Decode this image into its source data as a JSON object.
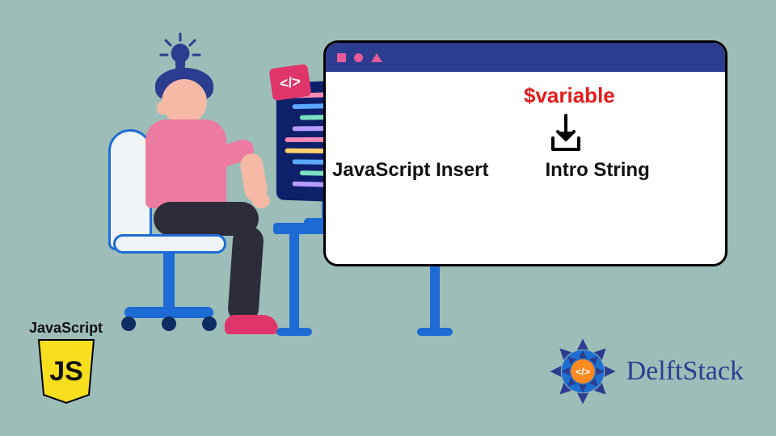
{
  "browser": {
    "variable": "$variable",
    "insert_left": "JavaScript Insert",
    "insert_right": "Intro String"
  },
  "code_badge": "</>",
  "js_logo": {
    "label": "JavaScript",
    "shield_text": "JS"
  },
  "delftstack": {
    "name": "DelftStack",
    "badge": "</>"
  },
  "colors": {
    "bg": "#9dbdb8",
    "accent_navy": "#2c3d8f",
    "accent_pink": "#e85a9b",
    "variable_red": "#e51b1b",
    "js_yellow": "#f7df1e"
  }
}
